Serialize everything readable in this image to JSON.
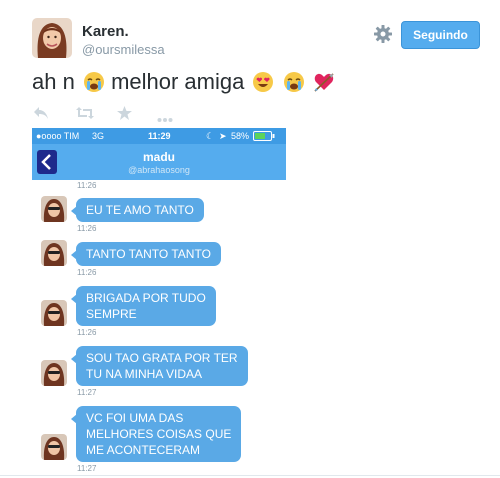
{
  "tweet": {
    "author_name": "Karen.",
    "author_handle": "@oursmilessa",
    "follow_label": "Seguindo",
    "text": "ah n",
    "text_2": "melhor amiga",
    "icons": {
      "settings": "gear-icon",
      "reply": "reply-icon",
      "retweet": "retweet-icon",
      "favorite": "star-icon",
      "more": "more-icon"
    }
  },
  "phone": {
    "carrier": "●oooo TIM",
    "network": "3G",
    "clock": "11:29",
    "battery": "58%",
    "contact_name": "madu",
    "contact_handle": "@abrahaosong",
    "first_time": "11:26",
    "messages": [
      {
        "text": "EU TE AMO TANTO",
        "time": "11:26"
      },
      {
        "text": "TANTO TANTO TANTO",
        "time": "11:26"
      },
      {
        "text": "BRIGADA POR TUDO\nSEMPRE",
        "time": "11:26"
      },
      {
        "text": "SOU TAO GRATA POR TER\nTU NA MINHA VIDAA",
        "time": "11:27"
      },
      {
        "text": "VC FOI UMA DAS\nMELHORES COISAS QUE\nME ACONTECERAM",
        "time": "11:27"
      }
    ]
  },
  "colors": {
    "follow_button": "#55acee",
    "bubble": "#5aa9e6",
    "nav_bar": "#55acee"
  }
}
